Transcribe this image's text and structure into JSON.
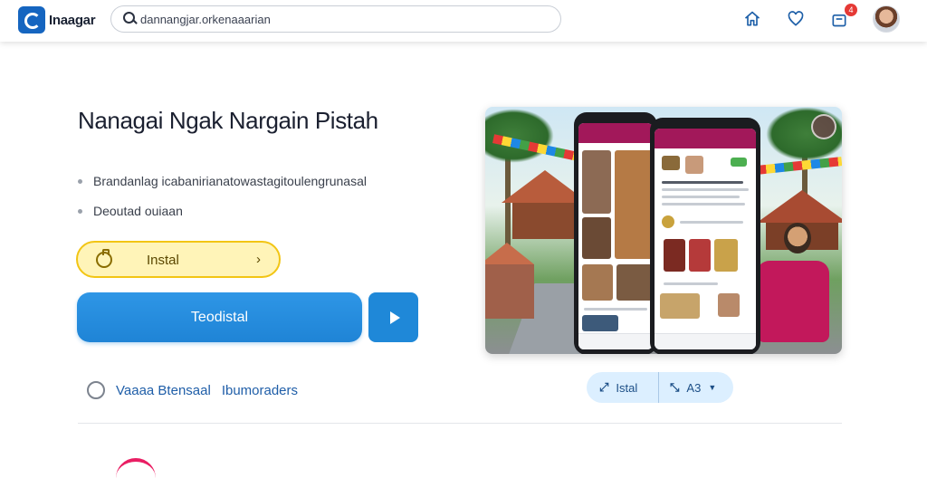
{
  "header": {
    "app_name": "Inaagar",
    "search_text": "dannangjar.orkenaaarian",
    "notification_count": "4"
  },
  "hero": {
    "title": "Nanagai Ngak Nargain Pistah",
    "bullets": [
      "Brandanlag icabanirianatowastagitoulengrunasal",
      "Deoutad ouiaan"
    ],
    "install_label": "Instal",
    "primary_button_label": "Teodistal",
    "radio_label_1": "Vaaaa Btensaal",
    "radio_label_2": "Ibumoraders"
  },
  "pill": {
    "left_label": "Istal",
    "right_label": "A3"
  },
  "colors": {
    "primary": "#1f84d6",
    "install_bg": "#fff4b8",
    "install_border": "#f2c514",
    "link": "#1f5ea8",
    "accent_pink": "#a2185a"
  },
  "icons": [
    "search-icon",
    "home-icon",
    "heart-icon",
    "bag-icon",
    "play-icon",
    "install-icon",
    "chevron-right-icon"
  ]
}
